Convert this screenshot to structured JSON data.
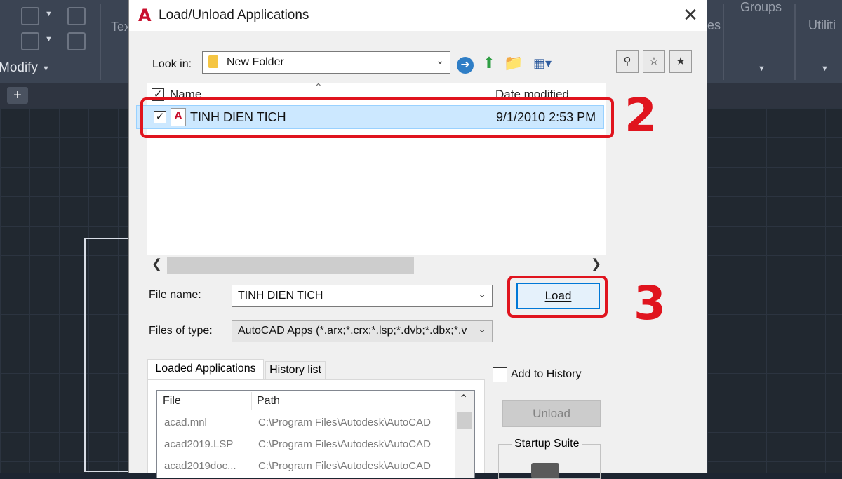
{
  "background": {
    "modify_label": "Modify",
    "groups_label": "Groups",
    "utilities_label": "Utiliti",
    "text_label_partial": "Tex",
    "es_label_partial": "es"
  },
  "dialog": {
    "title": "Load/Unload Applications",
    "close_icon": "close-icon",
    "look_in_label": "Look in:",
    "look_in_value": "New Folder",
    "column_name": "Name",
    "column_date": "Date modified",
    "file_row": {
      "name": "TINH DIEN TICH",
      "date": "9/1/2010 2:53 PM",
      "checked": true
    },
    "file_name_label": "File name:",
    "file_name_value": "TINH DIEN TICH",
    "files_of_type_label": "Files of type:",
    "files_of_type_value": "AutoCAD Apps (*.arx;*.crx;*.lsp;*.dvb;*.dbx;*.v",
    "load_button": "Load",
    "add_to_history_label": "Add to History",
    "unload_button": "Unload",
    "startup_suite_label": "Startup Suite",
    "tabs": [
      "Loaded Applications",
      "History list"
    ],
    "loaded_list": {
      "headers": [
        "File",
        "Path"
      ],
      "rows": [
        {
          "file": "acad.mnl",
          "path": "C:\\Program Files\\Autodesk\\AutoCAD"
        },
        {
          "file": "acad2019.LSP",
          "path": "C:\\Program Files\\Autodesk\\AutoCAD"
        },
        {
          "file": "acad2019doc...",
          "path": "C:\\Program Files\\Autodesk\\AutoCAD"
        }
      ]
    }
  },
  "annotations": {
    "step2": "2",
    "step3": "3"
  },
  "colors": {
    "highlight_red": "#e0141e",
    "selection_blue": "#cce8ff",
    "accent_blue": "#0078d7"
  }
}
